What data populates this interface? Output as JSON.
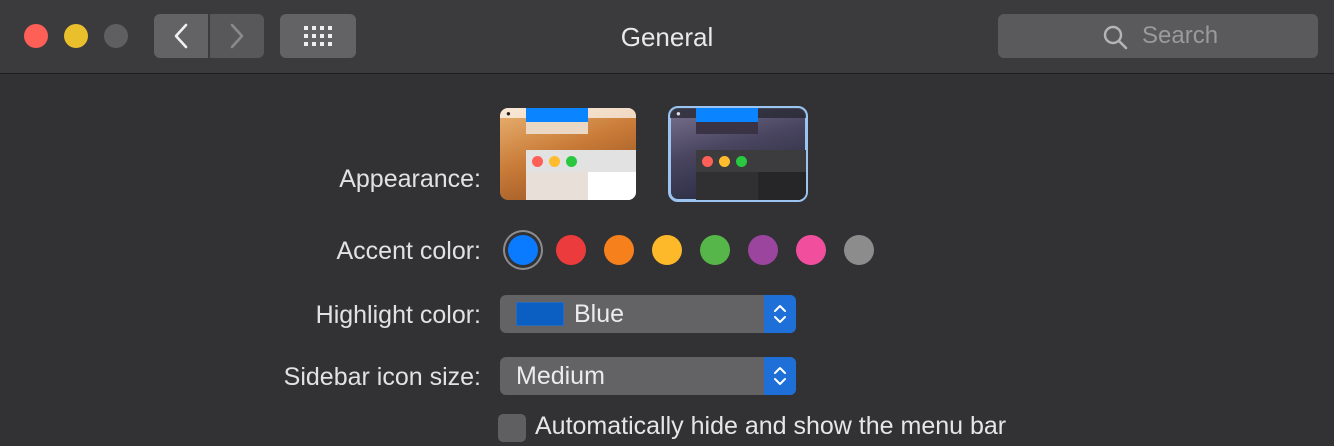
{
  "window": {
    "title": "General",
    "search_placeholder": "Search"
  },
  "appearance": {
    "label": "Appearance:",
    "options": [
      "light",
      "dark"
    ],
    "selected": "dark"
  },
  "accent": {
    "label": "Accent color:",
    "colors": [
      "#0a7aff",
      "#ec3b3d",
      "#f6801c",
      "#fdb92a",
      "#57b64a",
      "#9c459f",
      "#f14f9d",
      "#8c8c8c"
    ],
    "selected_index": 0
  },
  "highlight": {
    "label": "Highlight color:",
    "value": "Blue",
    "swatch_color": "#0b5ec2"
  },
  "sidebar_icon_size": {
    "label": "Sidebar icon size:",
    "value": "Medium"
  },
  "menu_bar": {
    "label": "Automatically hide and show the menu bar",
    "checked": false
  }
}
